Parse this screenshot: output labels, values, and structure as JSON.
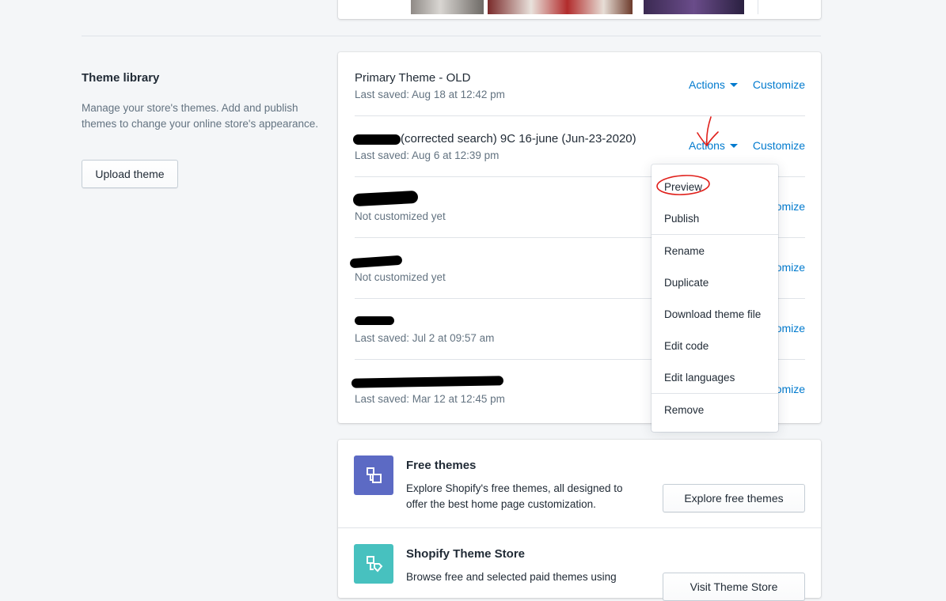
{
  "library": {
    "title": "Theme library",
    "description": "Manage your store's themes. Add and publish themes to change your online store's appearance.",
    "upload_label": "Upload theme",
    "themes": [
      {
        "name": "Primary Theme - OLD",
        "meta": "Last saved: Aug 18 at 12:42 pm"
      },
      {
        "name": "(corrected search) 9C 16-june (Jun-23-2020)",
        "meta": "Last saved: Aug 6 at 12:39 pm"
      },
      {
        "name": "",
        "meta": "Not customized yet"
      },
      {
        "name": "",
        "meta": "Not customized yet"
      },
      {
        "name": "",
        "meta": "Last saved: Jul 2 at 09:57 am"
      },
      {
        "name": "",
        "meta": "Last saved: Mar 12 at 12:45 pm"
      }
    ],
    "actions_label": "Actions",
    "customize_label": "Customize",
    "customize_partial": "tomize"
  },
  "menu": {
    "items": [
      "Preview",
      "Publish",
      "Rename",
      "Duplicate",
      "Download theme file",
      "Edit code",
      "Edit languages",
      "Remove"
    ]
  },
  "promos": {
    "free": {
      "title": "Free themes",
      "description": "Explore Shopify's free themes, all designed to offer the best home page customization.",
      "button": "Explore free themes",
      "icon_color": "#5c6ac4"
    },
    "store": {
      "title": "Shopify Theme Store",
      "description": "Browse free and selected paid themes using",
      "button": "Visit Theme Store",
      "icon_color": "#47c1bf"
    }
  },
  "colors": {
    "link": "#007ace",
    "annotation": "#e0201b"
  }
}
